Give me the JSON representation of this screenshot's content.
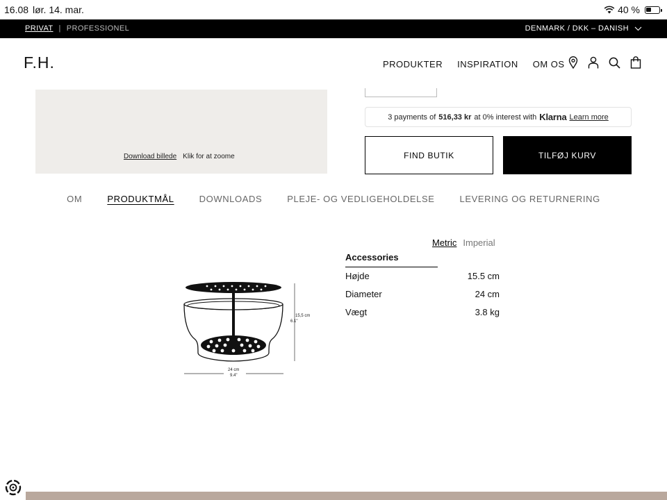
{
  "status_bar": {
    "time": "16.08",
    "date": "lør. 14. mar.",
    "battery": "40 %"
  },
  "top_bar": {
    "private": "PRIVAT",
    "separator": "|",
    "professional": "PROFESSIONEL",
    "locale": "DENMARK / DKK – DANISH"
  },
  "header": {
    "logo": "F.H.",
    "nav": [
      "PRODUKTER",
      "INSPIRATION",
      "OM OS"
    ]
  },
  "image": {
    "download_label": "Download billede",
    "zoom_label": "Klik for at zoome"
  },
  "klarna": {
    "prefix": "3 payments of",
    "amount": "516,33 kr",
    "middle": "at 0% interest with",
    "brand": "Klarna",
    "learn_more": "Learn more"
  },
  "buttons": {
    "find_store": "FIND BUTIK",
    "add_to_cart": "TILFØJ KURV"
  },
  "tabs": [
    "OM",
    "PRODUKTMÅL",
    "DOWNLOADS",
    "PLEJE- OG VEDLIGEHOLDELSE",
    "LEVERING OG RETURNERING"
  ],
  "active_tab": "PRODUKTMÅL",
  "drawing": {
    "height_cm": "15,5 cm",
    "height_in": "6.1\"",
    "width_cm": "24 cm",
    "width_in": "9.4\""
  },
  "dimensions": {
    "unit_metric": "Metric",
    "unit_imperial": "Imperial",
    "section": "Accessories",
    "rows": [
      {
        "label": "Højde",
        "value": "15.5 cm"
      },
      {
        "label": "Diameter",
        "value": "24 cm"
      },
      {
        "label": "Vægt",
        "value": "3.8 kg"
      }
    ]
  },
  "colors": {
    "top_bar": "#000000",
    "image_bg": "#efedea",
    "footer_strip": "#b9a89d",
    "primary_button": "#000000"
  }
}
